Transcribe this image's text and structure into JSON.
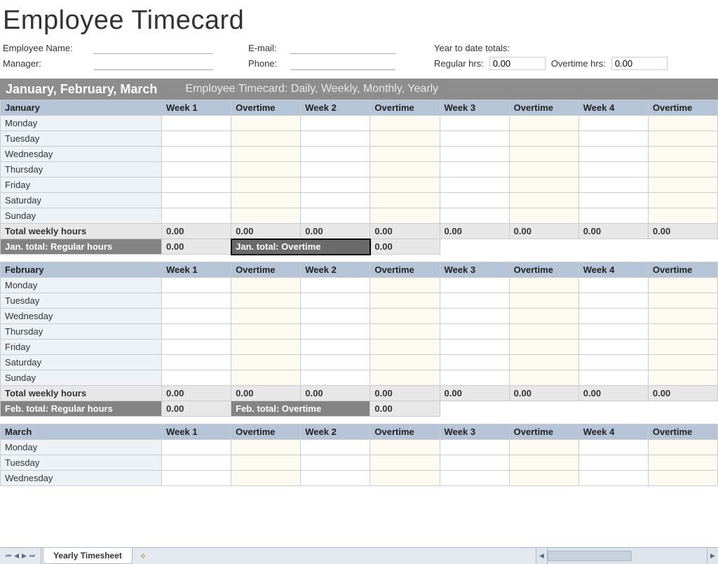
{
  "title": "Employee Timecard",
  "info": {
    "emp_name_label": "Employee Name:",
    "manager_label": "Manager:",
    "email_label": "E-mail:",
    "phone_label": "Phone:",
    "ytd_label": "Year to date totals:",
    "regular_label": "Regular hrs:",
    "regular_value": "0.00",
    "overtime_label": "Overtime hrs:",
    "overtime_value": "0.00"
  },
  "quarter": {
    "title": "January, February, March",
    "subtitle": "Employee Timecard: Daily, Weekly, Monthly, Yearly"
  },
  "columns": [
    "Week 1",
    "Overtime",
    "Week 2",
    "Overtime",
    "Week 3",
    "Overtime",
    "Week 4",
    "Overtime"
  ],
  "days": [
    "Monday",
    "Tuesday",
    "Wednesday",
    "Thursday",
    "Friday",
    "Saturday",
    "Sunday"
  ],
  "days_short": [
    "Monday",
    "Tuesday",
    "Wednesday"
  ],
  "months": {
    "jan": {
      "name": "January",
      "total_row_label": "Total weekly hours",
      "totals": [
        "0.00",
        "0.00",
        "0.00",
        "0.00",
        "0.00",
        "0.00",
        "0.00",
        "0.00"
      ],
      "month_total_reg_label": "Jan. total: Regular hours",
      "month_total_reg_value": "0.00",
      "month_total_ot_label": "Jan. total: Overtime",
      "month_total_ot_value": "0.00"
    },
    "feb": {
      "name": "February",
      "total_row_label": "Total weekly hours",
      "totals": [
        "0.00",
        "0.00",
        "0.00",
        "0.00",
        "0.00",
        "0.00",
        "0.00",
        "0.00"
      ],
      "month_total_reg_label": "Feb. total: Regular hours",
      "month_total_reg_value": "0.00",
      "month_total_ot_label": "Feb.  total: Overtime",
      "month_total_ot_value": "0.00"
    },
    "mar": {
      "name": "March"
    }
  },
  "footer": {
    "tab_name": "Yearly Timesheet"
  }
}
